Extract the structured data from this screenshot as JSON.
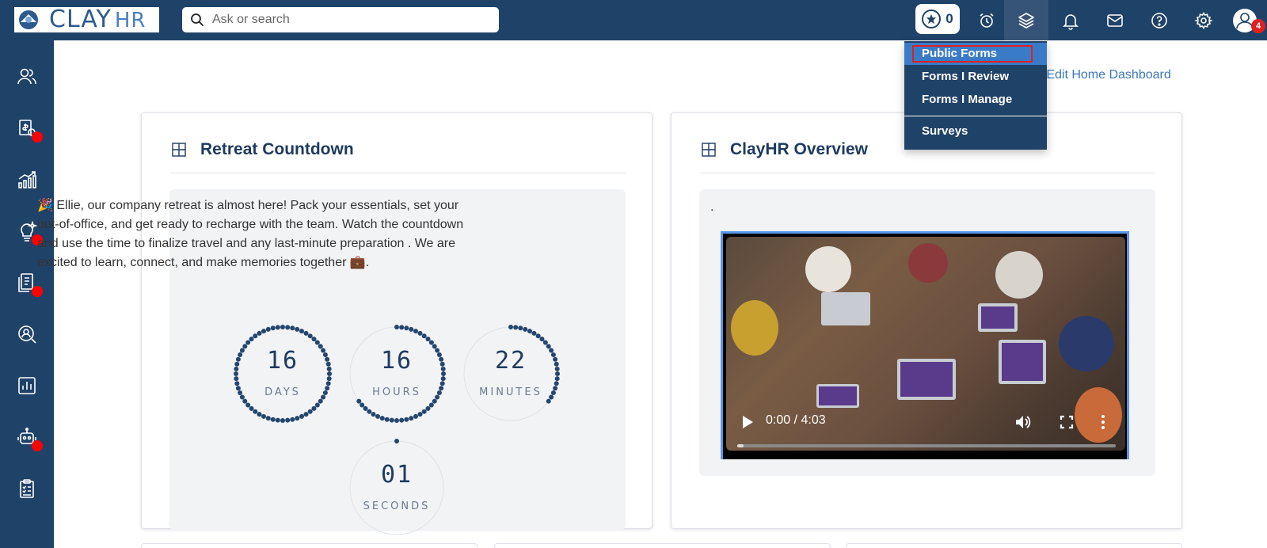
{
  "header": {
    "logo_text": "CLAY",
    "logo_suffix": "HR",
    "search_placeholder": "Ask or search",
    "points_count": "0",
    "avatar_badge": "4"
  },
  "dropdown": {
    "items": [
      "Public Forms",
      "Forms I Review",
      "Forms I Manage",
      "Surveys"
    ],
    "selected": "Public Forms"
  },
  "edit_dashboard_label": "Edit Home Dashboard",
  "countdown_card": {
    "title": "Retreat Countdown",
    "message": "Ellie, our company retreat is almost here! Pack your essentials, set your out-of-office, and get ready to recharge with the team. Watch the countdown and use the time to finalize travel and any last-minute preparation   . We are excited to learn, connect, and make memories together",
    "units": [
      {
        "value": "16",
        "label": "DAYS",
        "progress": 1.0
      },
      {
        "value": "16",
        "label": "HOURS",
        "progress": 0.67
      },
      {
        "value": "22",
        "label": "MINUTES",
        "progress": 0.37
      },
      {
        "value": "01",
        "label": "SECONDS",
        "progress": 0.02
      }
    ]
  },
  "overview_card": {
    "title": "ClayHR Overview",
    "panel_text": ".",
    "video_time": "0:00 / 4:03",
    "video_progress": 0.0
  },
  "colors": {
    "nav_bg": "#1f4268",
    "accent": "#3a78b8",
    "ring": "#24466e",
    "alert": "#ff0000"
  }
}
